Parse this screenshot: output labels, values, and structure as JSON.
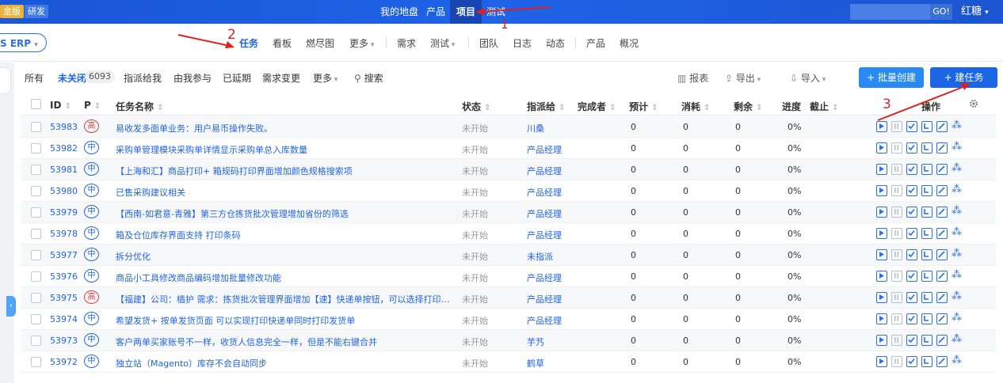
{
  "topbar": {
    "edition_badge": "金版",
    "dev_badge": "研发",
    "nav": [
      "我的地盘",
      "产品",
      "项目",
      "测试"
    ],
    "active_nav": "项目",
    "search_go": "GO!",
    "user": "红糖"
  },
  "subnav": {
    "project": "S ERP",
    "items": [
      "任务",
      "看板",
      "燃尽图",
      "更多",
      "需求",
      "测试",
      "团队",
      "日志",
      "动态",
      "产品",
      "概况"
    ],
    "active": "任务"
  },
  "filterbar": {
    "tabs": [
      "所有",
      "未关闭",
      "指派给我",
      "由我参与",
      "已延期",
      "需求变更",
      "更多"
    ],
    "active": "未关闭",
    "unclosed_count": "6093",
    "search": "搜索",
    "report": "报表",
    "export": "导出",
    "import": "导入",
    "batch_create": "+ 批量创建",
    "create_task": "+ 建任务"
  },
  "table": {
    "headers": {
      "id": "ID",
      "pri": "P",
      "name": "任务名称",
      "status": "状态",
      "assigned": "指派给",
      "finished_by": "完成者",
      "estimate": "预计",
      "consumed": "消耗",
      "left": "剩余",
      "progress": "进度",
      "deadline": "截止",
      "actions": "操作"
    },
    "rows": [
      {
        "id": "53983",
        "pri": "高",
        "name": "易收发多面单业务：用户易币操作失败。",
        "status": "未开始",
        "assigned": "川桑",
        "estimate": "0",
        "consumed": "0",
        "left": "0",
        "progress": "0%"
      },
      {
        "id": "53982",
        "pri": "中",
        "name": "采购单管理模块采购单详情显示采购单总入库数量",
        "status": "未开始",
        "assigned": "产品经理",
        "estimate": "0",
        "consumed": "0",
        "left": "0",
        "progress": "0%"
      },
      {
        "id": "53981",
        "pri": "中",
        "name": "【上海和汇】商品打印+ 箱规码打印界面增加颜色规格搜索项",
        "status": "未开始",
        "assigned": "产品经理",
        "estimate": "0",
        "consumed": "0",
        "left": "0",
        "progress": "0%"
      },
      {
        "id": "53980",
        "pri": "中",
        "name": "已售采购建议相关",
        "status": "未开始",
        "assigned": "产品经理",
        "estimate": "0",
        "consumed": "0",
        "left": "0",
        "progress": "0%"
      },
      {
        "id": "53979",
        "pri": "中",
        "name": "【西南-如君意-青雅】第三方仓拣货批次管理增加省份的筛选",
        "status": "未开始",
        "assigned": "产品经理",
        "estimate": "0",
        "consumed": "0",
        "left": "0",
        "progress": "0%"
      },
      {
        "id": "53978",
        "pri": "中",
        "name": "箱及仓位库存界面支持 打印条码",
        "status": "未开始",
        "assigned": "产品经理",
        "estimate": "0",
        "consumed": "0",
        "left": "0",
        "progress": "0%"
      },
      {
        "id": "53977",
        "pri": "中",
        "name": "拆分优化",
        "status": "未开始",
        "assigned": "未指派",
        "estimate": "0",
        "consumed": "0",
        "left": "0",
        "progress": "0%"
      },
      {
        "id": "53976",
        "pri": "中",
        "name": "商品小工具修改商品编码增加批量修改功能",
        "status": "未开始",
        "assigned": "产品经理",
        "estimate": "0",
        "consumed": "0",
        "left": "0",
        "progress": "0%"
      },
      {
        "id": "53975",
        "pri": "高",
        "name": "【福建】公司：樯护 需求：拣货批次管理界面增加【速】快递单按钮，可以选择打印机...",
        "status": "未开始",
        "assigned": "产品经理",
        "estimate": "0",
        "consumed": "0",
        "left": "0",
        "progress": "0%"
      },
      {
        "id": "53974",
        "pri": "中",
        "name": "希望发货+ 按单发货页面 可以实现打印快递单同时打印发货单",
        "status": "未开始",
        "assigned": "产品经理",
        "estimate": "0",
        "consumed": "0",
        "left": "0",
        "progress": "0%"
      },
      {
        "id": "53973",
        "pri": "中",
        "name": "客户两单买家账号不一样，收货人信息完全一样，但是不能右键合并",
        "status": "未开始",
        "assigned": "芋艿",
        "estimate": "0",
        "consumed": "0",
        "left": "0",
        "progress": "0%"
      },
      {
        "id": "53972",
        "pri": "中",
        "name": "独立站（Magento）库存不会自动同步",
        "status": "未开始",
        "assigned": "鹤草",
        "estimate": "0",
        "consumed": "0",
        "left": "0",
        "progress": "0%"
      }
    ]
  },
  "annotations": [
    "1",
    "2",
    "3"
  ],
  "colors": {
    "primary": "#1f63e8",
    "topbar": "#1a56d6",
    "high_priority": "#d93a3a",
    "arrow": "#e02020"
  }
}
